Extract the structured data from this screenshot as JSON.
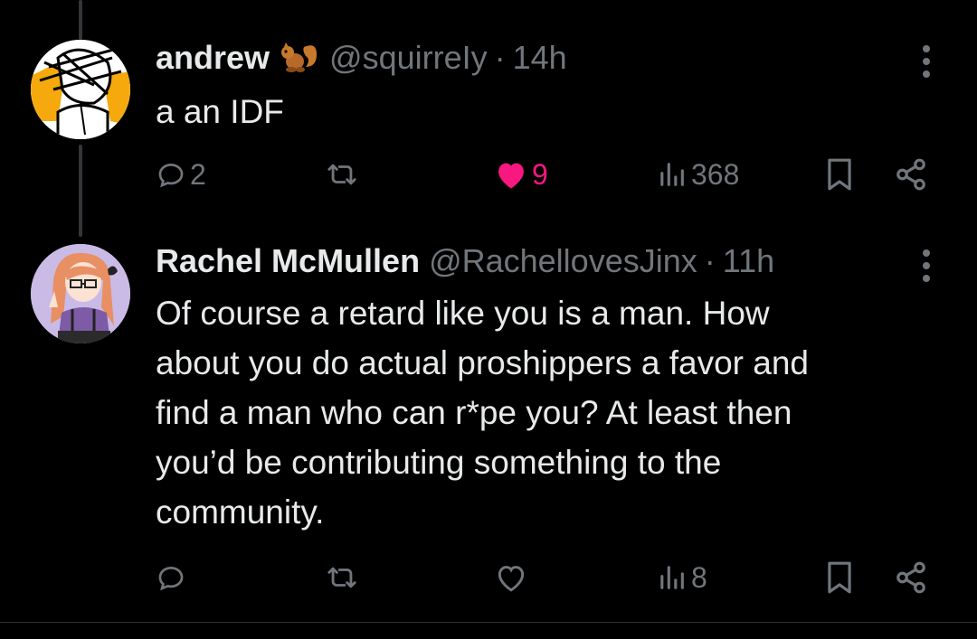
{
  "colors": {
    "background": "#000000",
    "text_primary": "#e7e9ea",
    "text_secondary": "#71767b",
    "like_active": "#f91880"
  },
  "tweets": [
    {
      "avatar": "avatar-sketch",
      "name": "andrew",
      "name_emoji": "squirrel-emoji",
      "handle": "@squirreIy",
      "separator": "·",
      "time": "14h",
      "text": "a an IDF",
      "actions": {
        "reply": {
          "icon": "reply-icon",
          "count": "2"
        },
        "repost": {
          "icon": "repost-icon",
          "count": ""
        },
        "like": {
          "icon": "heart-filled-icon",
          "count": "9",
          "active": true
        },
        "views": {
          "icon": "views-icon",
          "count": "368"
        },
        "bookmark": {
          "icon": "bookmark-icon"
        },
        "share": {
          "icon": "share-icon"
        }
      }
    },
    {
      "avatar": "avatar-anime",
      "name": "Rachel McMullen",
      "handle": "@RachellovesJinx",
      "separator": "·",
      "time": "11h",
      "text": "Of course a retard like you is a man. How\nabout you do actual proshippers a favor and\nfind a man who can r*pe you? At least then\nyou’d be contributing something to the\ncommunity.",
      "actions": {
        "reply": {
          "icon": "reply-icon",
          "count": ""
        },
        "repost": {
          "icon": "repost-icon",
          "count": ""
        },
        "like": {
          "icon": "heart-outline-icon",
          "count": "",
          "active": false
        },
        "views": {
          "icon": "views-icon",
          "count": "8"
        },
        "bookmark": {
          "icon": "bookmark-icon"
        },
        "share": {
          "icon": "share-icon"
        }
      }
    }
  ]
}
